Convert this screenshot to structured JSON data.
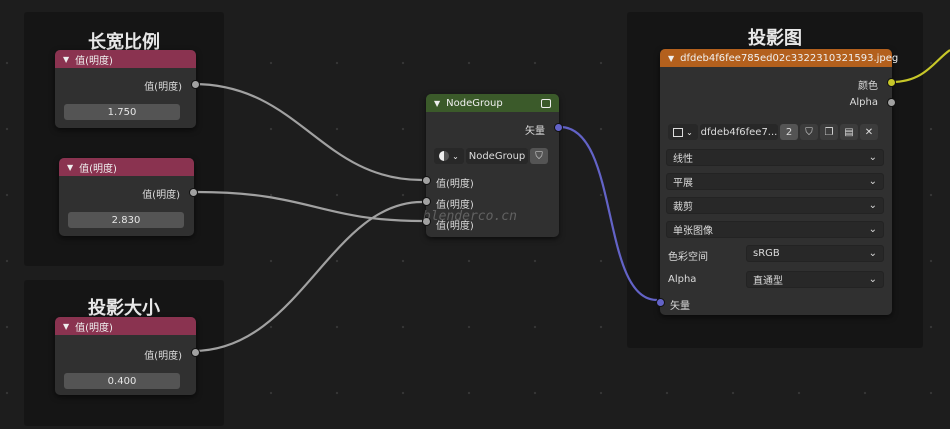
{
  "frames": {
    "aspect": {
      "title": "长宽比例"
    },
    "size": {
      "title": "投影大小"
    },
    "projection": {
      "title": "投影图"
    }
  },
  "value_nodes": [
    {
      "header": "值(明度)",
      "output": "值(明度)",
      "value": "1.750"
    },
    {
      "header": "值(明度)",
      "output": "值(明度)",
      "value": "2.830"
    },
    {
      "header": "值(明度)",
      "output": "值(明度)",
      "value": "0.400"
    }
  ],
  "node_group": {
    "header": "NodeGroup",
    "output": "矢量",
    "group_name": "NodeGroup",
    "inputs": [
      "值(明度)",
      "值(明度)",
      "值(明度)"
    ]
  },
  "image_node": {
    "header": "dfdeb4f6fee785ed02c3322310321593.jpeg",
    "outputs": [
      "颜色",
      "Alpha"
    ],
    "image_name": "dfdeb4f6fee7...",
    "users": "2",
    "interpolation": "线性",
    "projection": "平展",
    "extension": "裁剪",
    "source": "单张图像",
    "color_space_label": "色彩空间",
    "color_space": "sRGB",
    "alpha_label": "Alpha",
    "alpha_mode": "直通型",
    "input": "矢量"
  },
  "watermark": "blenderco.cn",
  "colors": {
    "value_header": "#8a3350",
    "group_header": "#3b5a2a",
    "image_header": "#b3601d",
    "link_grey": "#a1a1a1",
    "link_vector": "#6363c7",
    "link_color": "#c7c729"
  }
}
